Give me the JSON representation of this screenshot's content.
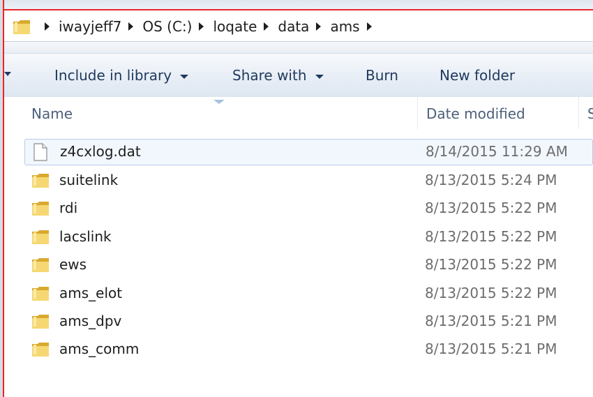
{
  "breadcrumb": [
    "iwayjeff7",
    "OS (C:)",
    "loqate",
    "data",
    "ams"
  ],
  "toolbar": {
    "include_in_library": "Include in library",
    "share_with": "Share with",
    "burn": "Burn",
    "new_folder": "New folder"
  },
  "columns": {
    "name": "Name",
    "date_modified": "Date modified",
    "size": "S"
  },
  "files": [
    {
      "name": "z4cxlog.dat",
      "date": "8/14/2015 11:29 AM",
      "type": "file",
      "selected": true
    },
    {
      "name": "suitelink",
      "date": "8/13/2015 5:24 PM",
      "type": "folder"
    },
    {
      "name": "rdi",
      "date": "8/13/2015 5:22 PM",
      "type": "folder"
    },
    {
      "name": "lacslink",
      "date": "8/13/2015 5:22 PM",
      "type": "folder"
    },
    {
      "name": "ews",
      "date": "8/13/2015 5:22 PM",
      "type": "folder"
    },
    {
      "name": "ams_elot",
      "date": "8/13/2015 5:22 PM",
      "type": "folder"
    },
    {
      "name": "ams_dpv",
      "date": "8/13/2015 5:21 PM",
      "type": "folder"
    },
    {
      "name": "ams_comm",
      "date": "8/13/2015 5:21 PM",
      "type": "folder"
    }
  ],
  "colors": {
    "accent_text": "#1e395b",
    "frame_red": "#e8242b",
    "folder_yellow": "#f1cd5a",
    "selection_border": "#b6cde8"
  }
}
